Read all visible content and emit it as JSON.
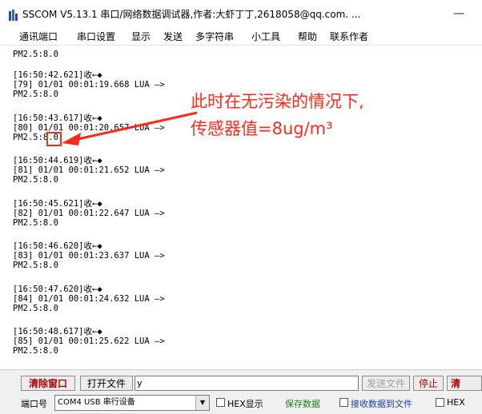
{
  "window": {
    "title": "SSCOM V5.13.1 串口/网络数据调试器,作者:大虾丁丁,2618058@qq.com. ...",
    "minimize_glyph": "—"
  },
  "menu": [
    "通讯端口",
    "串口设置",
    "显示",
    "发送",
    "多字符串",
    "小工具",
    "帮助",
    "联系作者"
  ],
  "log": {
    "first_line": "PM2.5:8.0",
    "entries": [
      {
        "recv": "[16:50:42.621]收←◆",
        "msg": "[79] 01/01 00:01:19.668 LUA —>",
        "value": "PM2.5:8.0"
      },
      {
        "recv": "[16:50:43.617]收←◆",
        "msg": "[80] 01/01 00:01:20.657 LUA —>",
        "value": "PM2.5:8.0"
      },
      {
        "recv": "[16:50:44.619]收←◆",
        "msg": "[81] 01/01 00:01:21.652 LUA —>",
        "value": "PM2.5:8.0"
      },
      {
        "recv": "[16:50:45.621]收←◆",
        "msg": "[82] 01/01 00:01:22.647 LUA —>",
        "value": "PM2.5:8.0"
      },
      {
        "recv": "[16:50:46.620]收←◆",
        "msg": "[83] 01/01 00:01:23.637 LUA —>",
        "value": "PM2.5:8.0"
      },
      {
        "recv": "[16:50:47.620]收←◆",
        "msg": "[84] 01/01 00:01:24.632 LUA —>",
        "value": "PM2.5:8.0"
      },
      {
        "recv": "[16:50:48.617]收←◆",
        "msg": "[85] 01/01 00:01:25.622 LUA —>",
        "value": "PM2.5:8.0"
      }
    ]
  },
  "annotation": {
    "line1": "此时在无污染的情况下,",
    "line2": "传感器值=8ug/m³",
    "color": "#ff2a1a"
  },
  "toolbar": {
    "clear_window": "清除窗口",
    "open_file": "打开文件",
    "send_input_value": "y",
    "send_file": "发送文件",
    "stop": "停止",
    "clear_send": "清"
  },
  "status": {
    "port_label": "端口号",
    "port_value": "COM4 USB 串行设备",
    "hex_display": "HEX显示",
    "save_data": "保存数据",
    "receive_to_file": "接收数据到文件",
    "hex_send": "HEX"
  }
}
